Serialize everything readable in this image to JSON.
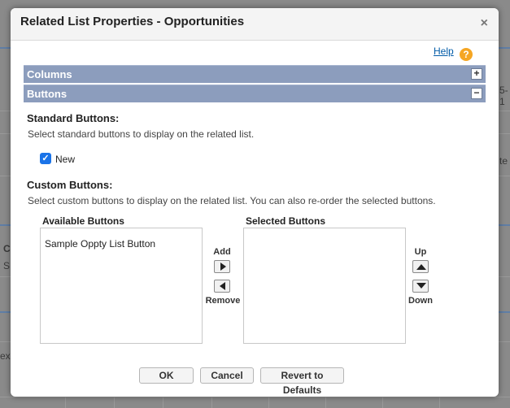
{
  "dialog": {
    "title": "Related List Properties - Opportunities",
    "close_glyph": "×",
    "help_label": "Help",
    "help_glyph": "?"
  },
  "sections": {
    "columns": {
      "label": "Columns",
      "toggle": "+"
    },
    "buttons": {
      "label": "Buttons",
      "toggle": "−"
    }
  },
  "standard_buttons": {
    "heading": "Standard Buttons:",
    "description": "Select standard buttons to display on the related list.",
    "options": [
      {
        "label": "New",
        "checked": true
      }
    ]
  },
  "custom_buttons": {
    "heading": "Custom Buttons:",
    "description": "Select custom buttons to display on the related list. You can also re-order the selected buttons.",
    "available_title": "Available Buttons",
    "available_items": [
      "Sample Oppty List Button"
    ],
    "selected_title": "Selected Buttons",
    "selected_items": [],
    "add_label": "Add",
    "remove_label": "Remove",
    "up_label": "Up",
    "down_label": "Down"
  },
  "footer": {
    "ok_label": "OK",
    "cancel_label": "Cancel",
    "revert_label": "Revert to Defaults"
  },
  "background_fragments": {
    "right_top": "5-1",
    "right_mid": "te",
    "left_c": "C",
    "left_s": "S",
    "left_ex": "ex"
  },
  "colors": {
    "section_bar": "#8c9dbd",
    "help_icon": "#f5a623",
    "checkbox": "#1a73e8",
    "link": "#015ba7"
  }
}
